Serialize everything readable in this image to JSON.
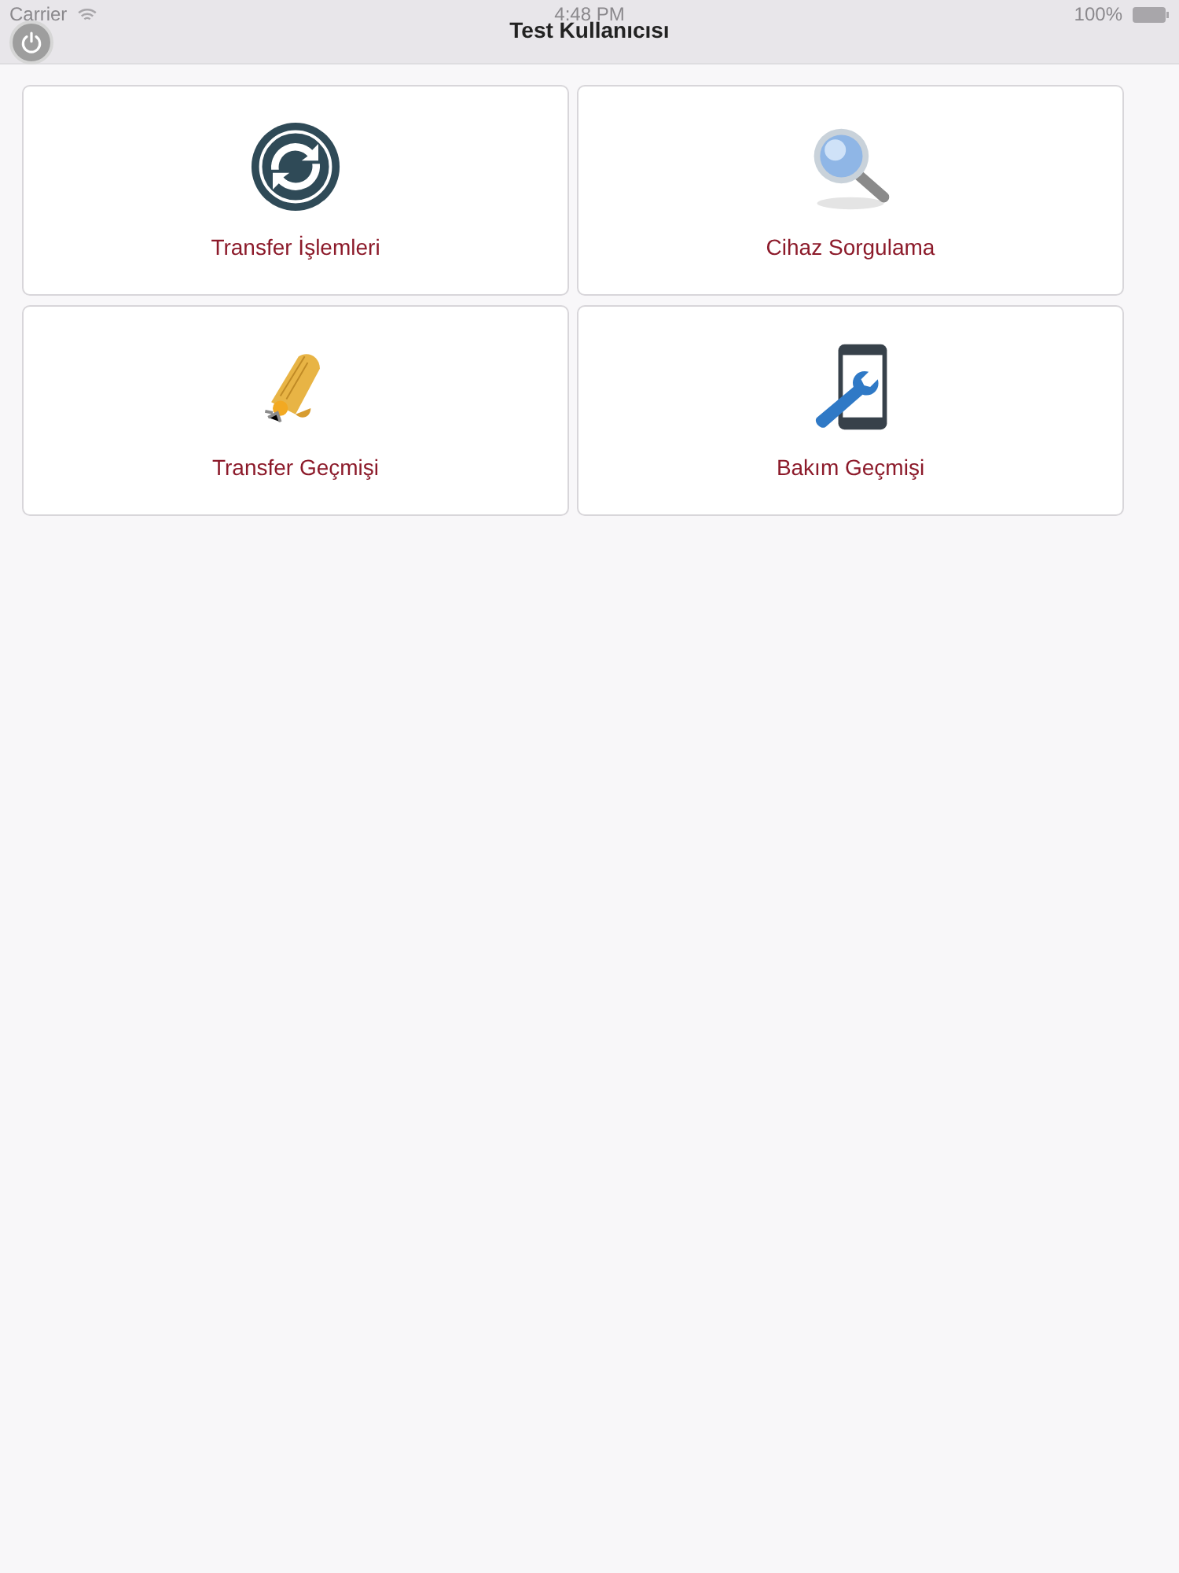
{
  "status_bar": {
    "carrier": "Carrier",
    "time": "4:48 PM",
    "battery": "100%"
  },
  "nav_bar": {
    "title": "Test Kullanıcısı"
  },
  "tiles": [
    {
      "kind": "sync",
      "label": "Transfer İşlemleri"
    },
    {
      "kind": "search",
      "label": "Cihaz Sorgulama"
    },
    {
      "kind": "scroll",
      "label": "Transfer Geçmişi"
    },
    {
      "kind": "phone-wrench",
      "label": "Bakım Geçmişi"
    }
  ]
}
